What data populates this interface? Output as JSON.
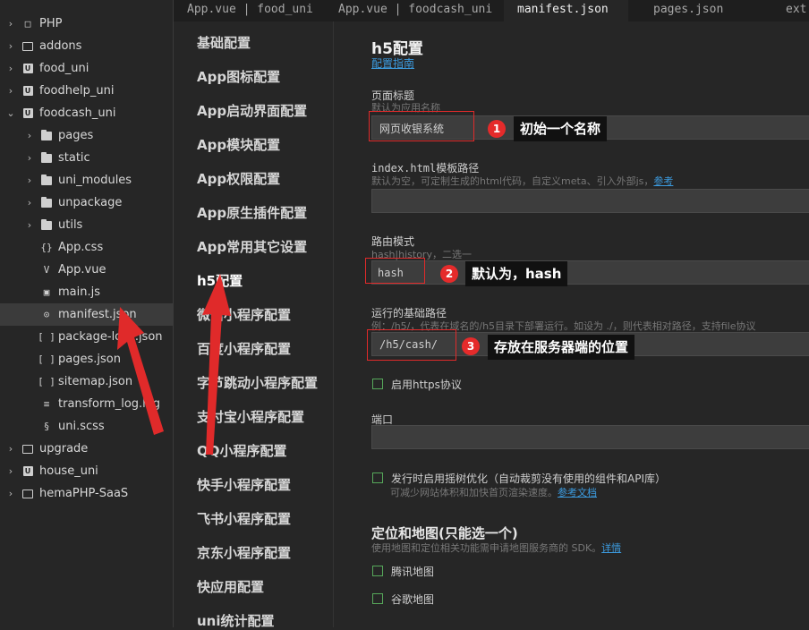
{
  "tree": [
    {
      "label": "PHP",
      "icon": "folder-closed-chevron",
      "type": "folder",
      "open": false
    },
    {
      "label": "addons",
      "icon": "plain-folder",
      "type": "folder",
      "open": false
    },
    {
      "label": "food_uni",
      "icon": "uniapp-project",
      "type": "project",
      "open": false
    },
    {
      "label": "foodhelp_uni",
      "icon": "uniapp-project",
      "type": "project",
      "open": false
    },
    {
      "label": "foodcash_uni",
      "icon": "uniapp-project",
      "type": "project",
      "open": true
    },
    {
      "label": "pages",
      "icon": "folder",
      "type": "folder",
      "open": false
    },
    {
      "label": "static",
      "icon": "folder",
      "type": "folder",
      "open": false
    },
    {
      "label": "uni_modules",
      "icon": "folder",
      "type": "folder",
      "open": false
    },
    {
      "label": "unpackage",
      "icon": "folder",
      "type": "folder",
      "open": false
    },
    {
      "label": "utils",
      "icon": "folder",
      "type": "folder",
      "open": false
    },
    {
      "label": "App.css",
      "icon": "css-file",
      "type": "file"
    },
    {
      "label": "App.vue",
      "icon": "vue-file",
      "type": "file"
    },
    {
      "label": "main.js",
      "icon": "js-file",
      "type": "file"
    },
    {
      "label": "manifest.json",
      "icon": "manifest-file",
      "type": "file",
      "selected": true
    },
    {
      "label": "package-lock.json",
      "icon": "json-file",
      "type": "file"
    },
    {
      "label": "pages.json",
      "icon": "json-file",
      "type": "file"
    },
    {
      "label": "sitemap.json",
      "icon": "json-file",
      "type": "file"
    },
    {
      "label": "transform_log.log",
      "icon": "log-file",
      "type": "file"
    },
    {
      "label": "uni.scss",
      "icon": "scss-file",
      "type": "file"
    },
    {
      "label": "upgrade",
      "icon": "plain-folder",
      "type": "folder",
      "open": false
    },
    {
      "label": "house_uni",
      "icon": "uniapp-project",
      "type": "project",
      "open": false
    },
    {
      "label": "hemaPHP-SaaS",
      "icon": "plain-folder",
      "type": "folder",
      "open": false
    }
  ],
  "tabs": [
    {
      "label": "App.vue | food_uni",
      "active": false
    },
    {
      "label": "App.vue | foodcash_uni",
      "active": false
    },
    {
      "label": "manifest.json",
      "active": true
    },
    {
      "label": "pages.json",
      "active": false
    },
    {
      "label": "ext.",
      "active": false
    }
  ],
  "config_nav": [
    "基础配置",
    "App图标配置",
    "App启动界面配置",
    "App模块配置",
    "App权限配置",
    "App原生插件配置",
    "App常用其它设置",
    "h5配置",
    "微信小程序配置",
    "百度小程序配置",
    "字节跳动小程序配置",
    "支付宝小程序配置",
    "QQ小程序配置",
    "快手小程序配置",
    "飞书小程序配置",
    "京东小程序配置",
    "快应用配置",
    "uni统计配置"
  ],
  "config_nav_active": "h5配置",
  "form": {
    "title": "h5配置",
    "guide_link": "配置指南",
    "page_title_label": "页面标题",
    "page_title_hint": "默认为应用名称",
    "page_title_value": "网页收银系统",
    "template_label": "index.html模板路径",
    "template_hint": "默认为空，可定制生成的html代码，自定义meta、引入外部js，",
    "template_hint_link": "参考",
    "template_value": "",
    "router_label": "路由模式",
    "router_hint": "hash|history，二选一",
    "router_value": "hash",
    "base_label": "运行的基础路径",
    "base_hint": "例：/h5/，代表在域名的/h5目录下部署运行。如设为 ./，则代表相对路径，支持file协议",
    "base_value": "/h5/cash/",
    "https_label": "启用https协议",
    "port_label": "端口",
    "port_value": "",
    "treeshake_label": "发行时启用摇树优化（自动裁剪没有使用的组件和API库）",
    "treeshake_hint": "可减少网站体积和加快首页渲染速度。",
    "treeshake_hint_link": "参考文档",
    "map_title": "定位和地图(只能选一个)",
    "map_hint": "使用地图和定位相关功能需申请地图服务商的 SDK。",
    "map_hint_link": "详情",
    "map_option_1": "腾讯地图",
    "map_option_2": "谷歌地图"
  },
  "annotations": [
    {
      "number": "1",
      "text": "初始一个名称"
    },
    {
      "number": "2",
      "text": "默认为，hash"
    },
    {
      "number": "3",
      "text": "存放在服务器端的位置"
    }
  ],
  "colors": {
    "annotation_red": "#e02a2a",
    "link_blue": "#3c9bdf",
    "checkbox_green": "#56a85a"
  }
}
